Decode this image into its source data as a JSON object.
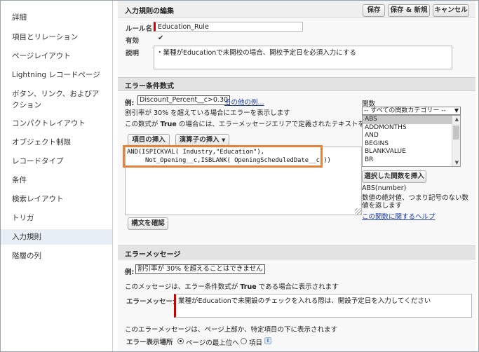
{
  "sidebar": {
    "items": [
      {
        "label": "詳細"
      },
      {
        "label": "項目とリレーション"
      },
      {
        "label": "ページレイアウト"
      },
      {
        "label": "Lightning レコードページ"
      },
      {
        "label": "ボタン、リンク、およびア"
      },
      {
        "label": "クション"
      },
      {
        "label": "コンパクトレイアウト"
      },
      {
        "label": "オブジェクト制限"
      },
      {
        "label": "レコードタイプ"
      },
      {
        "label": "条件"
      },
      {
        "label": "検索レイアウト"
      },
      {
        "label": "トリガ"
      },
      {
        "label": "入力規則"
      },
      {
        "label": "階層の列"
      }
    ]
  },
  "edit_section": {
    "title": "入力規則の編集",
    "save_label": "保存",
    "save_new_label": "保存 & 新規",
    "cancel_label": "キャンセル"
  },
  "fields": {
    "rule_name_label": "ルール名",
    "rule_name_value": "Education_Rule",
    "active_label": "有効",
    "active_checked": "✔",
    "description_label": "説明",
    "description_value": "・業種がEducationで未開校の場合、開校予定日を必須入力にする"
  },
  "error_condition": {
    "title": "エラー条件数式",
    "example_label": "例:",
    "example_value": "Discount_Percent__c>0.30",
    "more_examples_link": "その他の例...",
    "example_desc": "割引率が 30% を超えている場合にエラーを表示します",
    "true_desc_pre": "この数式が ",
    "true_word": "True",
    "true_desc_post": " の場合には、エラーメッセージエリアで定義されたテキストを表示します",
    "insert_field_label": "項目の挿入",
    "insert_operator_label": "演算子の挿入",
    "formula_line1": "AND(ISPICKVAL( Industry,\"Education\"),",
    "formula_line2": "Not_Opening__c,ISBLANK( OpeningScheduledDate__c ))",
    "check_syntax_label": "構文を確認",
    "functions_label": "関数",
    "function_category": "-- すべての関数カテゴリー --",
    "functions": [
      "ABS",
      "ADDMONTHS",
      "AND",
      "BEGINS",
      "BLANKVALUE",
      "BR"
    ],
    "insert_function_label": "選択した関数を挿入",
    "function_signature": "ABS(number)",
    "function_desc_line1": "数値の絶対値、つまり記号のない数",
    "function_desc_line2": "値を返します",
    "function_help_link": "この関数に関するヘルプ"
  },
  "error_message": {
    "title": "エラーメッセージ",
    "example_label": "例:",
    "example_value": "割引率が 30% を超えることはできません",
    "desc_pre": "このメッセージは、エラー条件数式が ",
    "true_word": "True",
    "desc_post": " である場合に表示されます",
    "message_label": "エラーメッセージ",
    "message_value": "業種がEducationで未開設のチェックを入れる際は、開設予定日を入力してください",
    "location_desc": "このエラーメッセージは、ページ上部か、特定項目の下に表示されます",
    "location_label": "エラー表示場所",
    "option_top": "ページの最上位へ",
    "option_field": "項目",
    "info_icon": "info-icon"
  }
}
